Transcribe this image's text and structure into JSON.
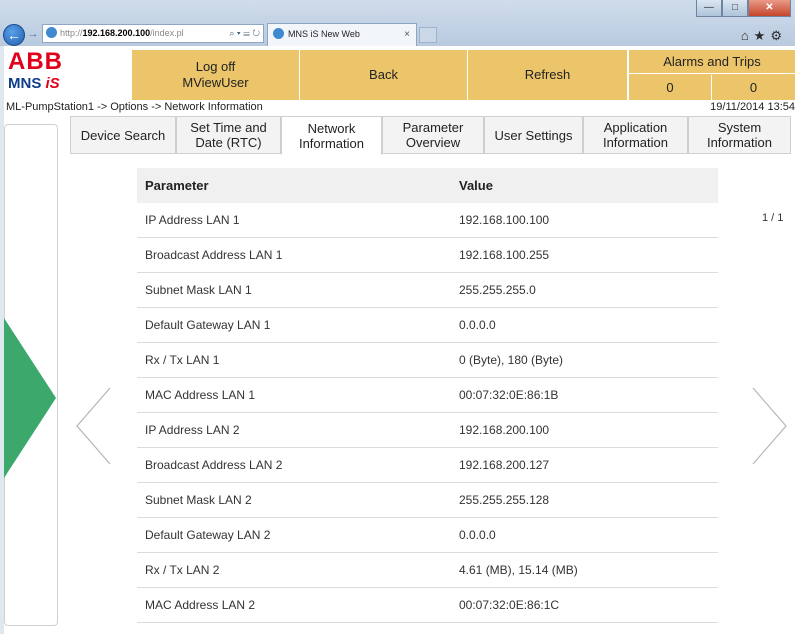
{
  "browser": {
    "address": {
      "prefix": "http://",
      "host": "192.168.200.100",
      "path": "/index.pl",
      "tools": "⌕ ▾ ☰ ↻"
    },
    "tab": {
      "title": "MNS iS New Web",
      "close": "×"
    },
    "toolbar_icons": "⌂★⚙"
  },
  "header": {
    "logo_abb": "ABB",
    "logo_mns": "MNS ",
    "logo_is": "iS",
    "logoff_label": "Log off",
    "logoff_user": "MViewUser",
    "back_label": "Back",
    "refresh_label": "Refresh",
    "alarms_title": "Alarms and Trips",
    "alarms_count": "0",
    "trips_count": "0"
  },
  "breadcrumb": "ML-PumpStation1 -> Options -> Network Information",
  "datetime": "19/11/2014 13:54",
  "tabs": [
    {
      "label": "Device Search"
    },
    {
      "label": "Set Time and Date (RTC)"
    },
    {
      "label": "Network Information",
      "active": true
    },
    {
      "label": "Parameter Overview"
    },
    {
      "label": "User Settings"
    },
    {
      "label": "Application Information"
    },
    {
      "label": "System Information"
    }
  ],
  "table": {
    "columns": [
      "Parameter",
      "Value"
    ],
    "rows": [
      [
        "IP Address LAN 1",
        "192.168.100.100"
      ],
      [
        "Broadcast Address LAN 1",
        "192.168.100.255"
      ],
      [
        "Subnet Mask LAN 1",
        "255.255.255.0"
      ],
      [
        "Default Gateway LAN 1",
        "0.0.0.0"
      ],
      [
        "Rx / Tx LAN 1",
        "0 (Byte), 180 (Byte)"
      ],
      [
        "MAC Address LAN 1",
        "00:07:32:0E:86:1B"
      ],
      [
        "IP Address LAN 2",
        "192.168.200.100"
      ],
      [
        "Broadcast Address LAN 2",
        "192.168.200.127"
      ],
      [
        "Subnet Mask LAN 2",
        "255.255.255.128"
      ],
      [
        "Default Gateway LAN 2",
        "0.0.0.0"
      ],
      [
        "Rx / Tx LAN 2",
        "4.61 (MB), 15.14 (MB)"
      ],
      [
        "MAC Address LAN 2",
        "00:07:32:0E:86:1C"
      ]
    ]
  },
  "page_indicator": "1 / 1",
  "colors": {
    "header_button": "#ecc56a",
    "abb_red": "#e2001a",
    "mns_blue": "#0e3d8c",
    "green_indicator": "#3ca86c"
  },
  "icons": [
    "ie-icon",
    "back-arrow-icon",
    "forward-arrow-icon",
    "home-icon",
    "star-icon",
    "gear-icon",
    "prev-page-icon",
    "next-page-icon"
  ]
}
